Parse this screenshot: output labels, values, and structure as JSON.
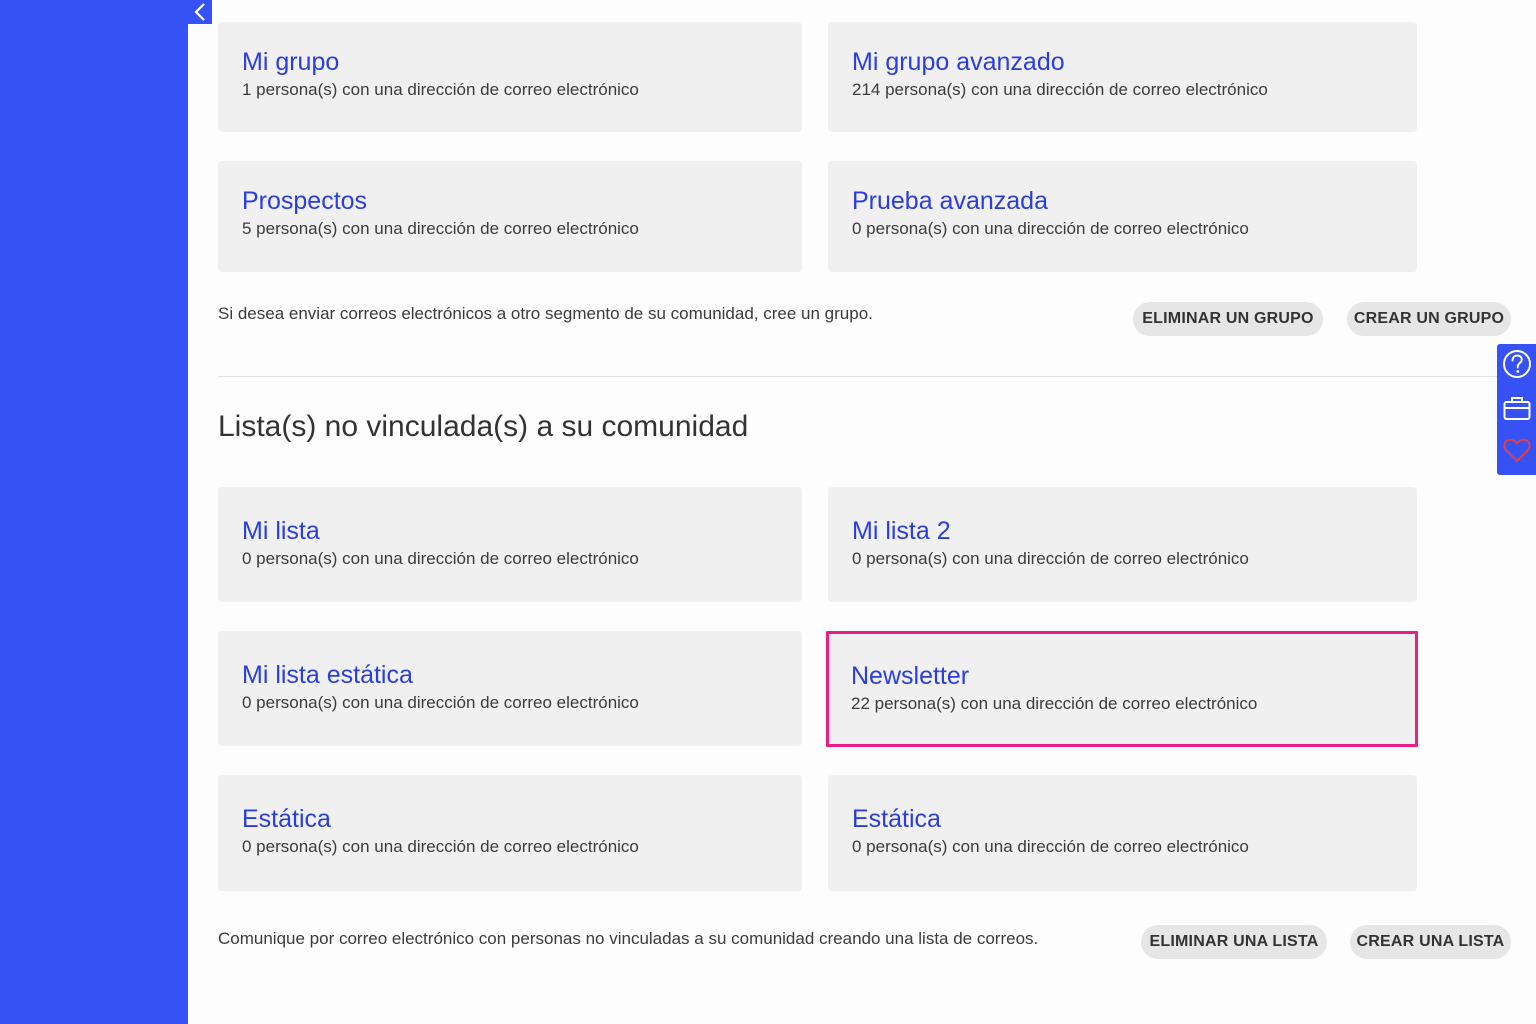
{
  "colors": {
    "sidebar": "#3652f5",
    "link": "#2a3de0",
    "highlight": "#ea1e87",
    "card": "#f0f0f1",
    "pill": "#e6e6e6"
  },
  "nav": {
    "collapse_icon": "chevron-left-icon"
  },
  "groups": {
    "cards": [
      {
        "title": "Mi grupo",
        "subtitle": "1 persona(s) con una dirección de correo electrónico"
      },
      {
        "title": "Mi grupo avanzado",
        "subtitle": "214 persona(s) con una dirección de correo electrónico"
      },
      {
        "title": "Prospectos",
        "subtitle": "5 persona(s) con una dirección de correo electrónico"
      },
      {
        "title": "Prueba avanzada",
        "subtitle": "0 persona(s) con una dirección de correo electrónico"
      }
    ],
    "help_text": "Si desea enviar correos electrónicos a otro segmento de su comunidad, cree un grupo.",
    "delete_label": "ELIMINAR UN GRUPO",
    "create_label": "CREAR UN GRUPO"
  },
  "lists": {
    "title": "Lista(s) no vinculada(s) a su comunidad",
    "cards": [
      {
        "title": "Mi lista",
        "subtitle": "0 persona(s) con una dirección de correo electrónico"
      },
      {
        "title": "Mi lista 2",
        "subtitle": "0 persona(s) con una dirección de correo electrónico"
      },
      {
        "title": "Mi lista estática",
        "subtitle": "0 persona(s) con una dirección de correo electrónico"
      },
      {
        "title": "Newsletter",
        "subtitle": "22 persona(s) con una dirección de correo electrónico",
        "highlighted": true
      },
      {
        "title": "Estática",
        "subtitle": "0 persona(s) con una dirección de correo electrónico"
      },
      {
        "title": "Estática",
        "subtitle": "0 persona(s) con una dirección de correo electrónico"
      }
    ],
    "help_text": "Comunique por correo electrónico con personas no vinculadas a su comunidad creando una lista de correos.",
    "delete_label": "ELIMINAR UNA LISTA",
    "create_label": "CREAR UNA LISTA"
  },
  "side_widget": {
    "icons": [
      "help-circle-icon",
      "toolbox-icon",
      "heart-icon"
    ]
  }
}
